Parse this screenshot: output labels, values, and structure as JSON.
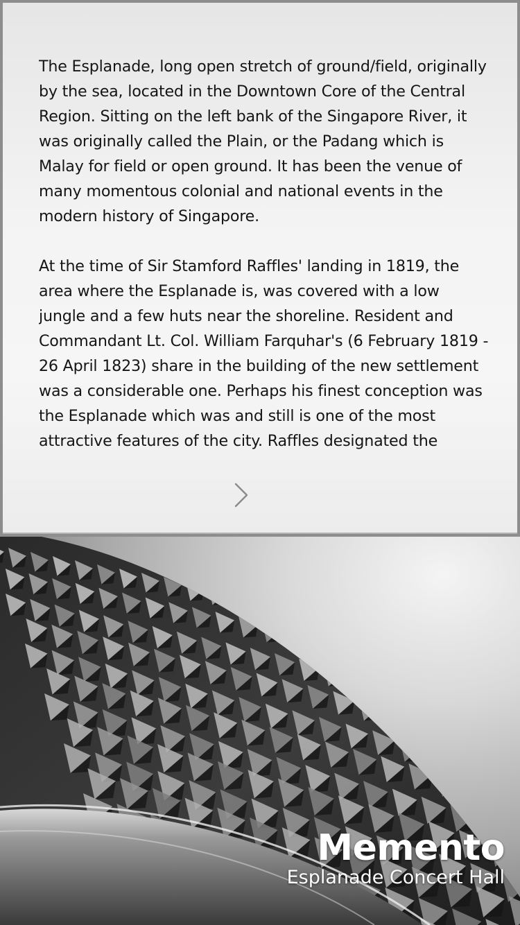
{
  "article": {
    "paragraphs": [
      "The Esplanade, long open stretch of ground/field, originally by the sea, located in the Downtown Core of the Central Region. Sitting on the left bank of the Singapore River, it was originally called the Plain, or the Padang which is Malay for field or open ground. It has been the venue of many momentous colonial and national events in the modern history of Singapore.",
      "At the time of Sir Stamford Raffles' landing in 1819, the area where the Esplanade is, was covered with a low jungle and a few huts near the shoreline. Resident and Commandant Lt. Col. William Farquhar's (6 February 1819 - 26 April 1823) share in the building of the new settlement was a considerable one. Perhaps his finest conception was the Esplanade which was and still is one of the most attractive features of the city. Raffles designated the"
    ],
    "next_icon": "chevron-right-icon"
  },
  "photo": {
    "title": "Memento",
    "subtitle": "Esplanade Concert Hall",
    "icon": "building-photo"
  },
  "colors": {
    "panel_border": "#8d8d8d",
    "text": "#151515",
    "caption": "#ffffff"
  }
}
